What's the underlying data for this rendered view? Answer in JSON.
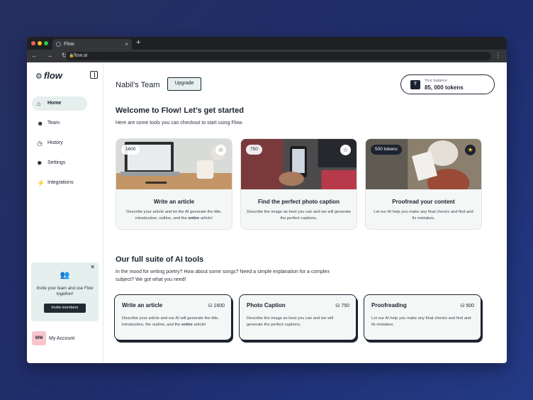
{
  "browser": {
    "tab_title": "Flow",
    "url": "flow.ai",
    "nav_icons": "← → ↻",
    "tab_close": "×",
    "new_tab": "+",
    "menu": "⋮"
  },
  "sidebar": {
    "logo": "flow",
    "items": [
      {
        "label": "Home",
        "icon": "home-icon",
        "glyph": "⌂"
      },
      {
        "label": "Team",
        "icon": "team-icon",
        "glyph": "☻"
      },
      {
        "label": "History",
        "icon": "history-icon",
        "glyph": "◷"
      },
      {
        "label": "Settings",
        "icon": "gear-icon",
        "glyph": "✹"
      },
      {
        "label": "Integrations",
        "icon": "bolt-icon",
        "glyph": "⚡"
      }
    ],
    "invite": {
      "text": "Invite your team and use Flow together!",
      "button": "Invite members"
    },
    "account": {
      "initials": "WM",
      "label": "My Account"
    }
  },
  "header": {
    "team_name": "Nabil’s Team",
    "upgrade": "Upgrade",
    "balance_label": "Your balance",
    "balance_value": "85, 000 tokens"
  },
  "welcome": {
    "title": "Welcome to Flow! Let’s get started",
    "subtitle": "Here are some tools you can checkout to start using Flow."
  },
  "cards": [
    {
      "badge": "1600",
      "title": "Write an article",
      "desc": "Describe your article and let the AI generate the title, introduction, outline, and the entire article!",
      "starred": false
    },
    {
      "badge": "750",
      "title": "Find the perfect photo caption",
      "desc": "Describe the image as best you can and we will generate the perfect captions.",
      "starred": false
    },
    {
      "badge": "500 tokens",
      "title": "Proofread your content",
      "desc": "Let our AI help you make any final checks and find and fix mistakes.",
      "starred": true
    }
  ],
  "suite": {
    "title": "Our full suite of AI tools",
    "subtitle": "In the mood for writing poetry? How about some songs? Need a simple explanation for a complex subject? We got what you need!"
  },
  "tools": [
    {
      "title": "Write an article",
      "tokens": "1600",
      "desc": "Describe your article and our AI will generate the title, introduction, the outline, and the entire article!"
    },
    {
      "title": "Photo Caption",
      "tokens": "750",
      "desc": "Describe the image as best you can and we will generate the perfect captions."
    },
    {
      "title": "Proofreading",
      "tokens": "500",
      "desc": "Let our AI help you make any final checks and find and fix mistakes."
    }
  ]
}
